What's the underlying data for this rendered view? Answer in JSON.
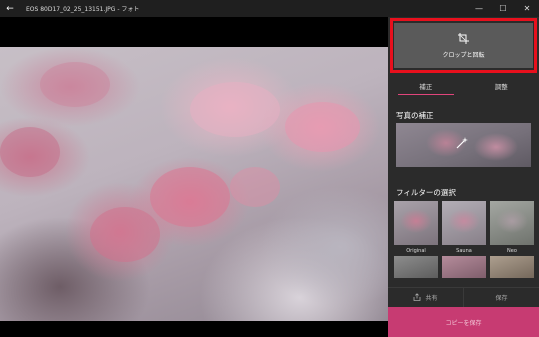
{
  "window": {
    "title": "EOS 80D17_02_25_13151.JPG - フォト",
    "back_icon": "←",
    "minimize_icon": "—",
    "maximize_icon": "☐",
    "close_icon": "✕"
  },
  "panel": {
    "crop_button": {
      "label": "クロップと回転",
      "icon": "crop-rotate-icon"
    },
    "tabs": [
      {
        "label": "補正",
        "active": true
      },
      {
        "label": "調整",
        "active": false
      }
    ],
    "enhance_title": "写真の補正",
    "filters_title": "フィルターの選択",
    "filters": [
      {
        "label": "Original"
      },
      {
        "label": "Sauna"
      },
      {
        "label": "Neo"
      },
      {
        "label": ""
      },
      {
        "label": ""
      },
      {
        "label": ""
      }
    ],
    "share_label": "共有",
    "save_label": "保存",
    "copy_save_label": "コピーを保存"
  },
  "colors": {
    "accent": "#e0457b",
    "highlight": "#e8101d",
    "copy_save_bg": "#c73b72"
  }
}
